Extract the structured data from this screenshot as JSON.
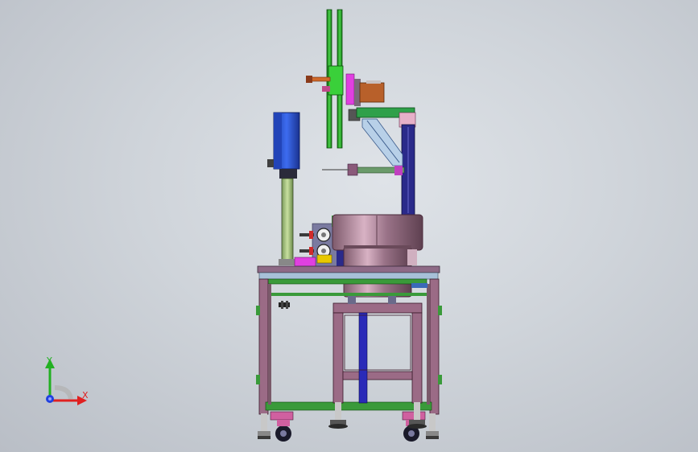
{
  "triad": {
    "x_label": "X",
    "y_label": "Y",
    "colors": {
      "x": "#e02020",
      "y": "#22b022",
      "z": "#2040e0"
    }
  },
  "palette": {
    "frame": "#9b6b86",
    "rail": "#3a9a3a",
    "column": "#2a2a8a",
    "hopper": "#b8899e",
    "cabinet": "#2a54d8",
    "reel": "#2ab02a",
    "motor": "#b8602a",
    "magenta": "#e040e0",
    "yellow": "#e8c800",
    "table": "#8e6a86"
  }
}
